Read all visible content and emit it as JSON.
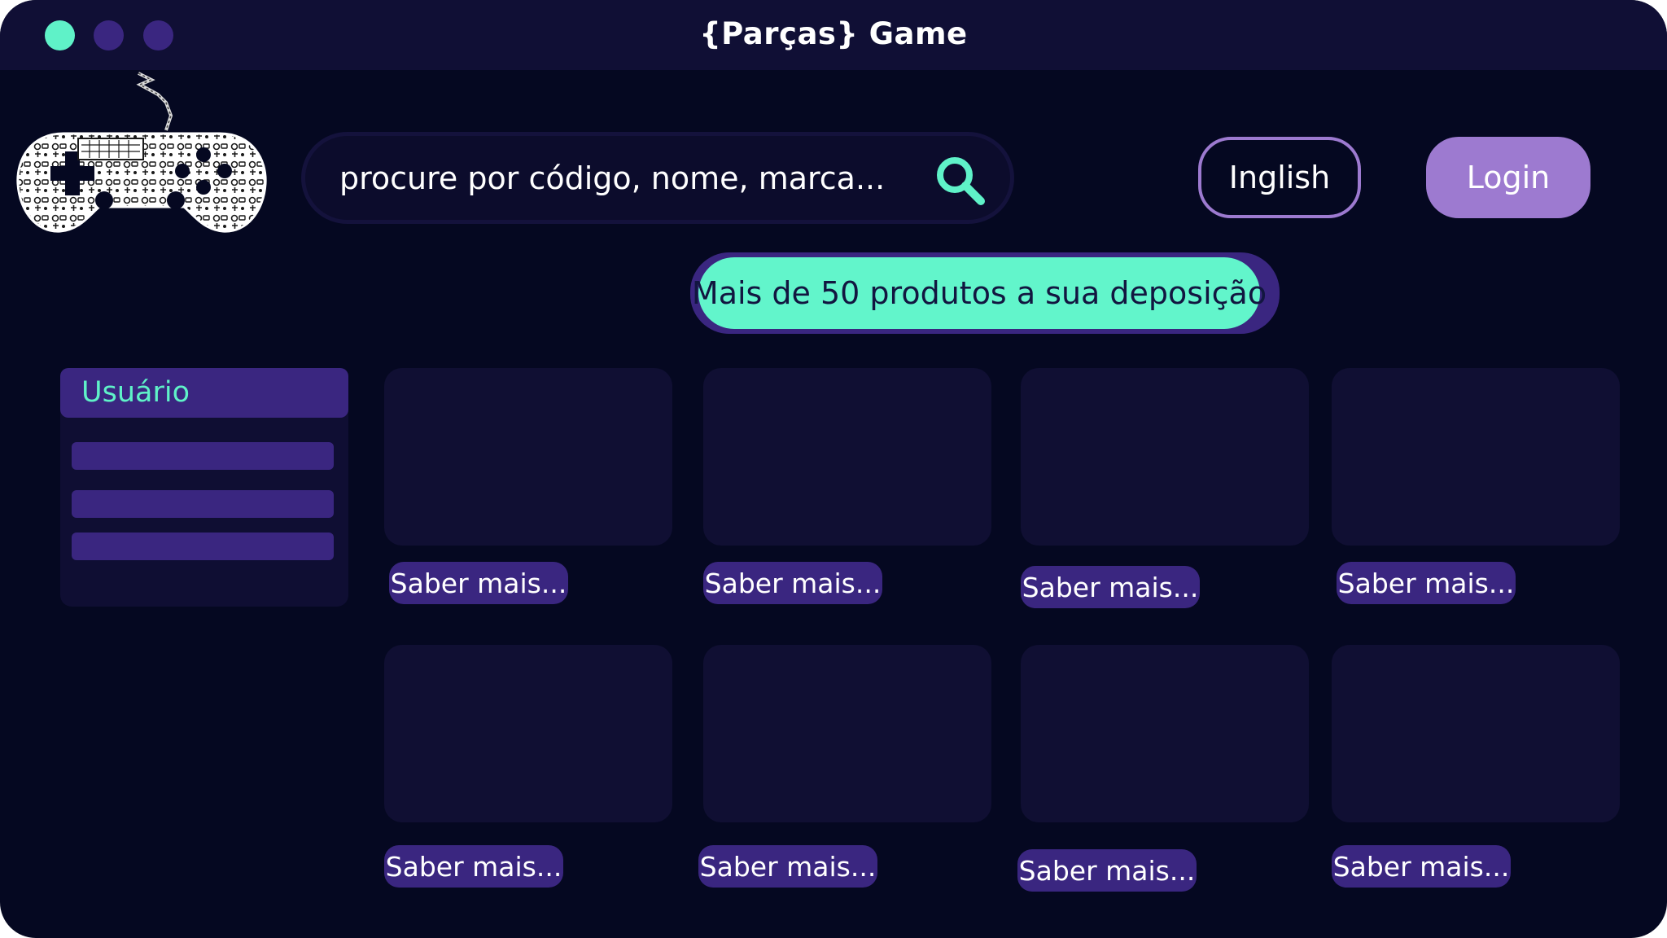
{
  "window": {
    "title": "{Parças} Game",
    "controls": [
      "close",
      "minimize",
      "maximize"
    ],
    "colors": {
      "background": "#050821",
      "titlebar": "#100f35",
      "accent_teal": "#5ff2c8",
      "accent_purple": "#9d7ad0",
      "deep_purple": "#3a2680"
    }
  },
  "logo": {
    "icon": "game-controller-collage-icon"
  },
  "search": {
    "placeholder": "procure por código, nome, marca...",
    "icon": "search-icon"
  },
  "header": {
    "language_label": "Inglish",
    "login_label": "Login"
  },
  "banner": {
    "text": "Mais de 50 produtos a sua deposição"
  },
  "sidebar": {
    "title": "Usuário",
    "items": [
      "",
      "",
      ""
    ]
  },
  "products": [
    {
      "button_label": "Saber mais..."
    },
    {
      "button_label": "Saber mais..."
    },
    {
      "button_label": "Saber mais..."
    },
    {
      "button_label": "Saber mais..."
    },
    {
      "button_label": "Saber mais..."
    },
    {
      "button_label": "Saber mais..."
    },
    {
      "button_label": "Saber mais..."
    },
    {
      "button_label": "Saber mais..."
    }
  ]
}
